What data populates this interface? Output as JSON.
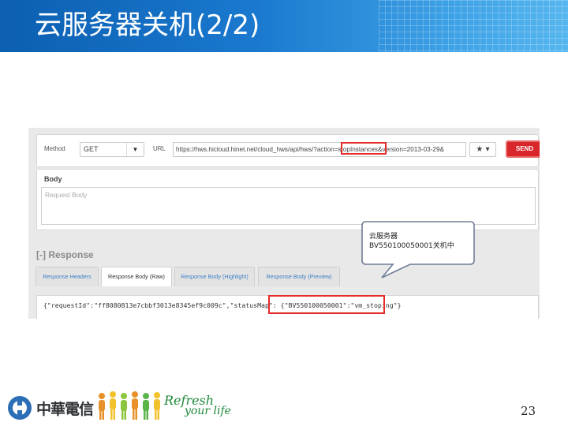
{
  "title": "云服务器关机(2/2)",
  "request": {
    "method_label": "Method",
    "method_value": "GET",
    "dropdown_glyph": "▼",
    "url_label": "URL",
    "url_value": "https://hws.hicloud.hinet.net/cloud_hws/api/hws/?action=stopInstances&version=2013-03-29&",
    "star_glyph": "★ ▾",
    "send_label": "SEND"
  },
  "body": {
    "title": "Body",
    "placeholder": "Request Body"
  },
  "response": {
    "title": "[-] Response",
    "tabs": [
      {
        "label": "Response Headers",
        "active": false
      },
      {
        "label": "Response Body (Raw)",
        "active": true
      },
      {
        "label": "Response Body (Highlight)",
        "active": false
      },
      {
        "label": "Response Body (Preview)",
        "active": false
      }
    ],
    "raw_text": "{\"requestId\":\"ff8080813e7cbbf3013e8345ef9c009c\",\"statusMap\": {\"BV550100050001\":\"vm_stoping\"}"
  },
  "callout": {
    "line1": "云服务器",
    "line2": "BV550100050001关机中"
  },
  "footer": {
    "company": "中華電信",
    "slogan_line1": "Refresh",
    "slogan_line2": "your life",
    "page_number": "23"
  },
  "colors": {
    "title_bar": "#1a79cf",
    "send_button": "#d9262a",
    "highlight": "#e52b2b",
    "slogan": "#1f8a3a"
  }
}
